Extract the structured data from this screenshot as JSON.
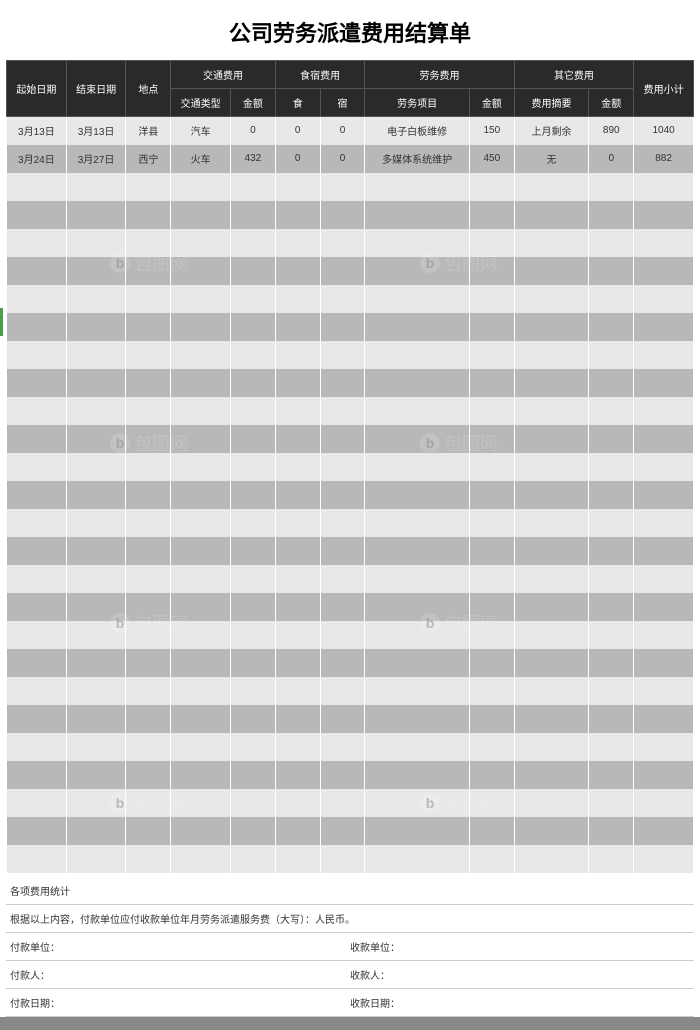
{
  "title": "公司劳务派遣费用结算单",
  "headers": {
    "start_date": "起始日期",
    "end_date": "结束日期",
    "location": "地点",
    "transport": "交通费用",
    "transport_type": "交通类型",
    "transport_amount": "金额",
    "lodging": "食宿费用",
    "meal": "食",
    "stay": "宿",
    "labor": "劳务费用",
    "labor_item": "劳务项目",
    "labor_amount": "金额",
    "other": "其它费用",
    "other_desc": "费用摘要",
    "other_amount": "金额",
    "subtotal": "费用小计"
  },
  "rows": [
    {
      "start_date": "3月13日",
      "end_date": "3月13日",
      "location": "洋县",
      "transport_type": "汽车",
      "transport_amount": "0",
      "meal": "0",
      "stay": "0",
      "labor_item": "电子白板维修",
      "labor_amount": "150",
      "other_desc": "上月剩余",
      "other_amount": "890",
      "subtotal": "1040"
    },
    {
      "start_date": "3月24日",
      "end_date": "3月27日",
      "location": "西宁",
      "transport_type": "火车",
      "transport_amount": "432",
      "meal": "0",
      "stay": "0",
      "labor_item": "多媒体系统维护",
      "labor_amount": "450",
      "other_desc": "无",
      "other_amount": "0",
      "subtotal": "882"
    }
  ],
  "empty_rows": 25,
  "footer": {
    "stats": "各项费用统计",
    "note": "根据以上内容，付款单位应付收款单位年月劳务派遣服务费（大写）：人民币。",
    "payer_unit": "付款单位：",
    "payee_unit": "收款单位：",
    "payer": "付款人：",
    "payee": "收款人：",
    "pay_date": "付款日期：",
    "receive_date": "收款日期："
  },
  "watermark_text": "包图网"
}
